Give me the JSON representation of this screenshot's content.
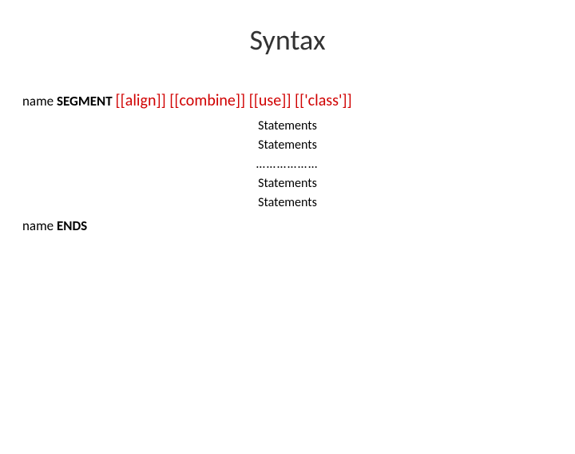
{
  "title": "Syntax",
  "line1": {
    "name": "name",
    "keyword": "SEGMENT",
    "params": "[[align]] [[combine]] [[use]] [['class']]"
  },
  "body": {
    "stmt1": "Statements",
    "stmt2": "Statements",
    "dots": "………………",
    "stmt3": "Statements",
    "stmt4": "Statements"
  },
  "lineEnd": {
    "name": "name",
    "keyword": "ENDS"
  }
}
